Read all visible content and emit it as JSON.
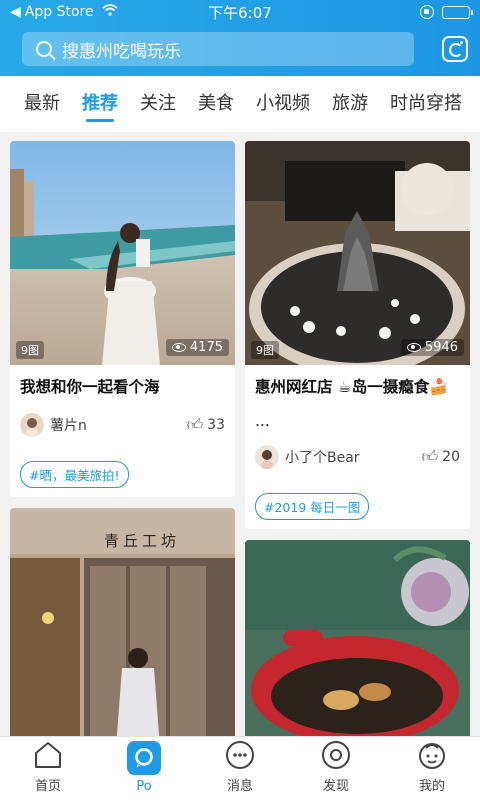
{
  "status_bar": {
    "back_label": "App Store",
    "time": "下午6:07"
  },
  "search": {
    "placeholder": "搜惠州吃喝玩乐"
  },
  "tabs": [
    {
      "label": "最新"
    },
    {
      "label": "推荐",
      "active": true
    },
    {
      "label": "关注"
    },
    {
      "label": "美食"
    },
    {
      "label": "小视频"
    },
    {
      "label": "旅游"
    },
    {
      "label": "时尚穿搭"
    }
  ],
  "feed": {
    "cards": [
      {
        "title": "我想和你一起看个海",
        "image_count": "9图",
        "views": "4175",
        "author": "薯片n",
        "likes": "33",
        "tag": "#晒，最美旅拍!"
      },
      {
        "title": "惠州网红店 ☕岛一摄瘾食🍰",
        "title_more": "...",
        "image_count": "9图",
        "views": "5946",
        "author": "小了个Bear",
        "likes": "20",
        "tag": "#2019 每日一图"
      },
      {
        "shop_sign": "青丘工坊"
      },
      {}
    ]
  },
  "bottom_nav": [
    {
      "label": "首页",
      "icon": "home-icon"
    },
    {
      "label": "Po",
      "icon": "po-icon",
      "active": true
    },
    {
      "label": "消息",
      "icon": "message-icon"
    },
    {
      "label": "发现",
      "icon": "discover-icon"
    },
    {
      "label": "我的",
      "icon": "profile-icon"
    }
  ],
  "colors": {
    "accent": "#1e9ae6",
    "header": "#27a9e8"
  }
}
